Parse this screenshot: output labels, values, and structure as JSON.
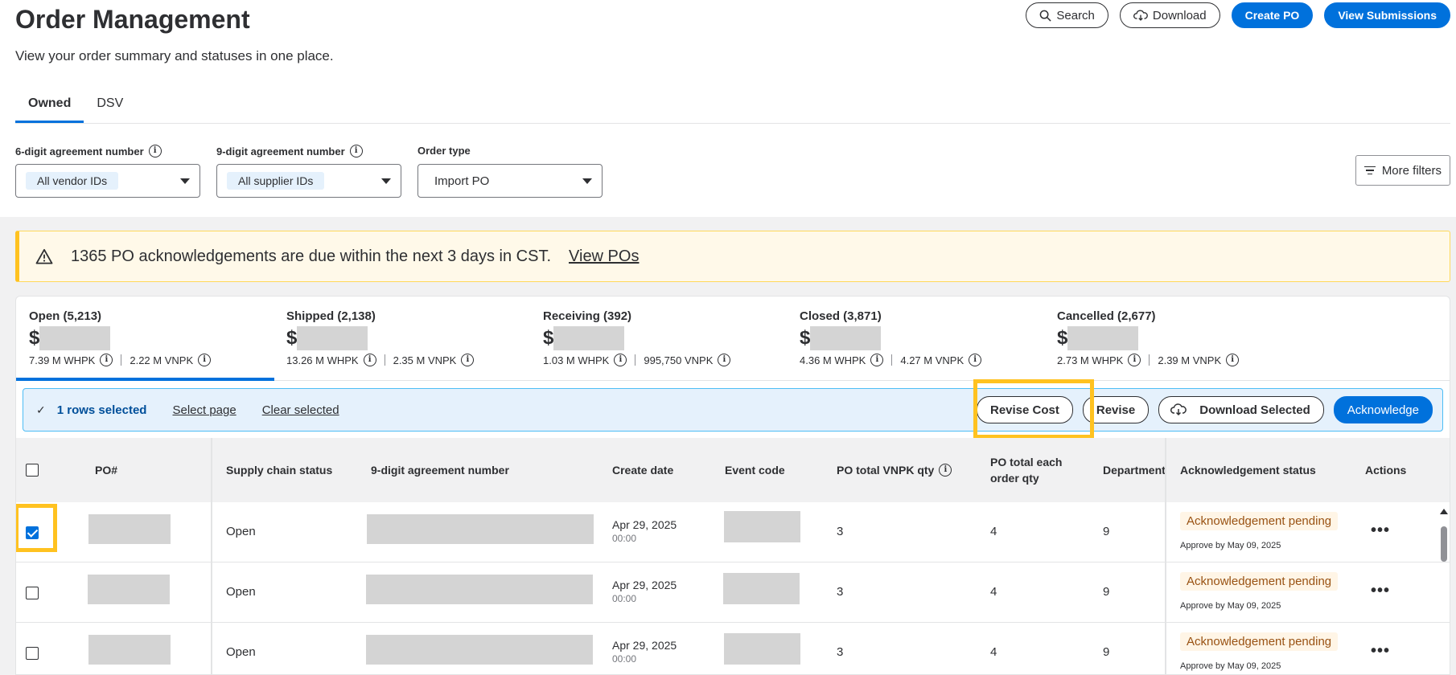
{
  "header": {
    "title": "Order Management",
    "subtitle": "View your order summary and statuses in one place.",
    "search_label": "Search",
    "download_label": "Download",
    "create_po_label": "Create PO",
    "view_submissions_label": "View Submissions"
  },
  "tabs": [
    {
      "label": "Owned",
      "active": true
    },
    {
      "label": "DSV",
      "active": false
    }
  ],
  "filters": {
    "agreement6": {
      "label": "6-digit agreement number",
      "value": "All vendor IDs"
    },
    "agreement9": {
      "label": "9-digit agreement number",
      "value": "All supplier IDs"
    },
    "order_type": {
      "label": "Order type",
      "value": "Import PO"
    },
    "more_filters_label": "More filters"
  },
  "alert": {
    "message": "1365 PO acknowledgements are due within the next 3 days in CST.",
    "link": "View POs"
  },
  "summary": [
    {
      "title": "Open (5,213)",
      "amount_prefix": "$",
      "whpk": "7.39 M WHPK",
      "vnpk": "2.22 M VNPK"
    },
    {
      "title": "Shipped (2,138)",
      "amount_prefix": "$",
      "whpk": "13.26 M WHPK",
      "vnpk": "2.35 M VNPK"
    },
    {
      "title": "Receiving (392)",
      "amount_prefix": "$",
      "whpk": "1.03 M WHPK",
      "vnpk": "995,750 VNPK"
    },
    {
      "title": "Closed (3,871)",
      "amount_prefix": "$",
      "whpk": "4.36 M WHPK",
      "vnpk": "4.27 M VNPK"
    },
    {
      "title": "Cancelled (2,677)",
      "amount_prefix": "$",
      "whpk": "2.73 M WHPK",
      "vnpk": "2.39 M VNPK"
    }
  ],
  "selection": {
    "rows_selected": "1 rows selected",
    "select_page": "Select page",
    "clear_selected": "Clear selected",
    "revise_cost": "Revise Cost",
    "revise": "Revise",
    "download_selected": "Download Selected",
    "acknowledge": "Acknowledge"
  },
  "table": {
    "headers": {
      "po": "PO#",
      "supply_chain_status": "Supply chain status",
      "agreement9": "9-digit agreement number",
      "create_date": "Create date",
      "event_code": "Event code",
      "vnpk_qty": "PO total VNPK qty",
      "each_qty": "PO total each order qty",
      "department": "Department",
      "ack_status": "Acknowledgement status",
      "actions": "Actions"
    },
    "rows": [
      {
        "checked": true,
        "status": "Open",
        "date": "Apr 29, 2025",
        "time": "00:00",
        "vnpk": "3",
        "each": "4",
        "dept": "9",
        "ack": "Acknowledgement pending",
        "approve": "Approve by May 09, 2025",
        "actions": "•••"
      },
      {
        "checked": false,
        "status": "Open",
        "date": "Apr 29, 2025",
        "time": "00:00",
        "vnpk": "3",
        "each": "4",
        "dept": "9",
        "ack": "Acknowledgement pending",
        "approve": "Approve by May 09, 2025",
        "actions": "•••"
      },
      {
        "checked": false,
        "status": "Open",
        "date": "Apr 29, 2025",
        "time": "00:00",
        "vnpk": "3",
        "each": "4",
        "dept": "9",
        "ack": "Acknowledgement pending",
        "approve": "Approve by May 09, 2025",
        "actions": "•••"
      }
    ]
  },
  "colors": {
    "primary": "#0071dc",
    "highlight": "#ffc220",
    "alert_bg": "#fff9e9",
    "pending_text": "#995213"
  }
}
